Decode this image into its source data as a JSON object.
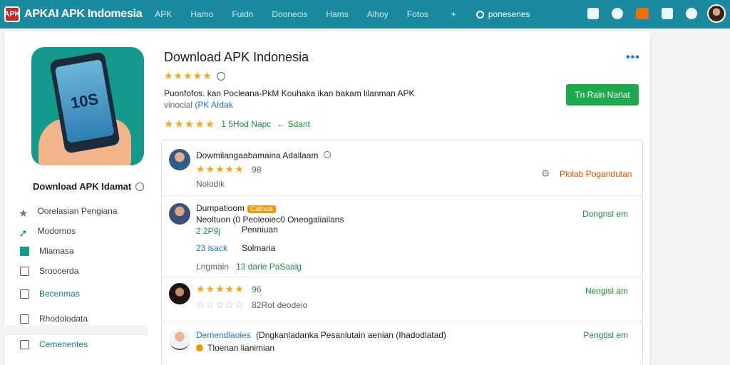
{
  "topbar": {
    "logo_badge": "APK",
    "logo_text": "APKAI APK Indomesia",
    "nav": [
      "APK",
      "Hamo",
      "Fuidn",
      "Doonecis",
      "Hams",
      "Alhoy",
      "Fotos"
    ],
    "plus": "+",
    "search_label": "ponesenes"
  },
  "app": {
    "icon_text": "10S",
    "title": "Download APK Indonesia",
    "desc_line1": "Puonfofos. kan Pocleana-PkM Kouhaka  ikan bakam lilanman APK",
    "desc_line2_prefix": "vinocial  ",
    "desc_line2_link": "(PK AIdak",
    "meta_count": "1 5Hod Napc",
    "meta_action": "← Sdant",
    "install_label": "Tn Rain Narlat",
    "more": "•••"
  },
  "sidebar": {
    "title": "Download APK Idamat",
    "items": [
      {
        "label": "Oorelasian Pengiana",
        "icon": "star-icon",
        "style": "star"
      },
      {
        "label": "Modornos",
        "icon": "arrow-icon",
        "style": "arrow"
      },
      {
        "label": "Mlamasa",
        "icon": "filled-square-icon",
        "style": "filled"
      },
      {
        "label": "Sroocerda",
        "icon": "checkbox-icon",
        "style": "empty"
      },
      {
        "label": "Becenmas",
        "icon": "checkbox-icon",
        "style": "empty-teal"
      },
      {
        "label": "Rhodolodata",
        "icon": "checkbox-icon",
        "style": "empty"
      },
      {
        "label": "Cemenentes",
        "icon": "checkbox-icon",
        "style": "empty-teal"
      }
    ]
  },
  "reviews": [
    {
      "name": "Dowmilangaabamaina Adallaam",
      "stars": "★★★★★",
      "count": "98",
      "sub": "Nolodik",
      "action": "Plolab Pogandutan",
      "action_icon": "gear-icon"
    },
    {
      "name": "Dumpatioom",
      "tag": "Calnua",
      "line1": "Neoltuon (0 Peoleoiec0 Oneogaliailans",
      "line2": "Penniuan",
      "green": "2 2P9j",
      "blue": "23 isack",
      "blue_after": "Solmaria",
      "footer_a": "Lngmain",
      "footer_b": "13 darle PaSaalg",
      "action": "Dongnsl em"
    },
    {
      "stars": "★★★★★",
      "count": "96",
      "stars2": "☆☆☆☆☆",
      "sub": "82Rot deodeio",
      "action": "Nengisl am"
    },
    {
      "name": "Demendlaoies",
      "text": "(Dngkanladanka Pesanlutain aenian (Ihadodlatad)",
      "sub": "Tloenan lianimian",
      "action": "Pengtisl em"
    }
  ]
}
